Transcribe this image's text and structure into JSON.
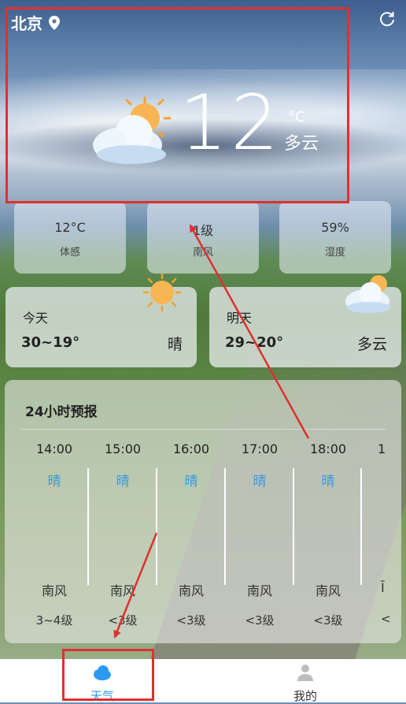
{
  "header": {
    "city": "北京"
  },
  "current": {
    "temp": "12",
    "unit": "°C",
    "condition": "多云"
  },
  "tiles": [
    {
      "value": "12°C",
      "label": "体感"
    },
    {
      "value": "1级",
      "label": "南风"
    },
    {
      "value": "59%",
      "label": "湿度"
    }
  ],
  "days": [
    {
      "label": "今天",
      "range": "30~19°",
      "weather": "晴"
    },
    {
      "label": "明天",
      "range": "29~20°",
      "weather": "多云"
    }
  ],
  "hourly": {
    "title": "24小时预报",
    "items": [
      {
        "time": "14:00",
        "weather": "晴",
        "wind_dir": "南风",
        "wind_speed": "3~4级"
      },
      {
        "time": "15:00",
        "weather": "晴",
        "wind_dir": "南风",
        "wind_speed": "<3级"
      },
      {
        "time": "16:00",
        "weather": "晴",
        "wind_dir": "南风",
        "wind_speed": "<3级"
      },
      {
        "time": "17:00",
        "weather": "晴",
        "wind_dir": "南风",
        "wind_speed": "<3级"
      },
      {
        "time": "18:00",
        "weather": "晴",
        "wind_dir": "南风",
        "wind_speed": "<3级"
      },
      {
        "time": "1",
        "weather": "",
        "wind_dir": "Ī",
        "wind_speed": "<"
      }
    ]
  },
  "tabs": [
    {
      "label": "天气",
      "icon": "cloud-icon",
      "active": true,
      "color": "#2b9af3"
    },
    {
      "label": "我的",
      "icon": "person-icon",
      "active": false,
      "color": "#333333"
    }
  ],
  "annotation_color": "#e0302e"
}
